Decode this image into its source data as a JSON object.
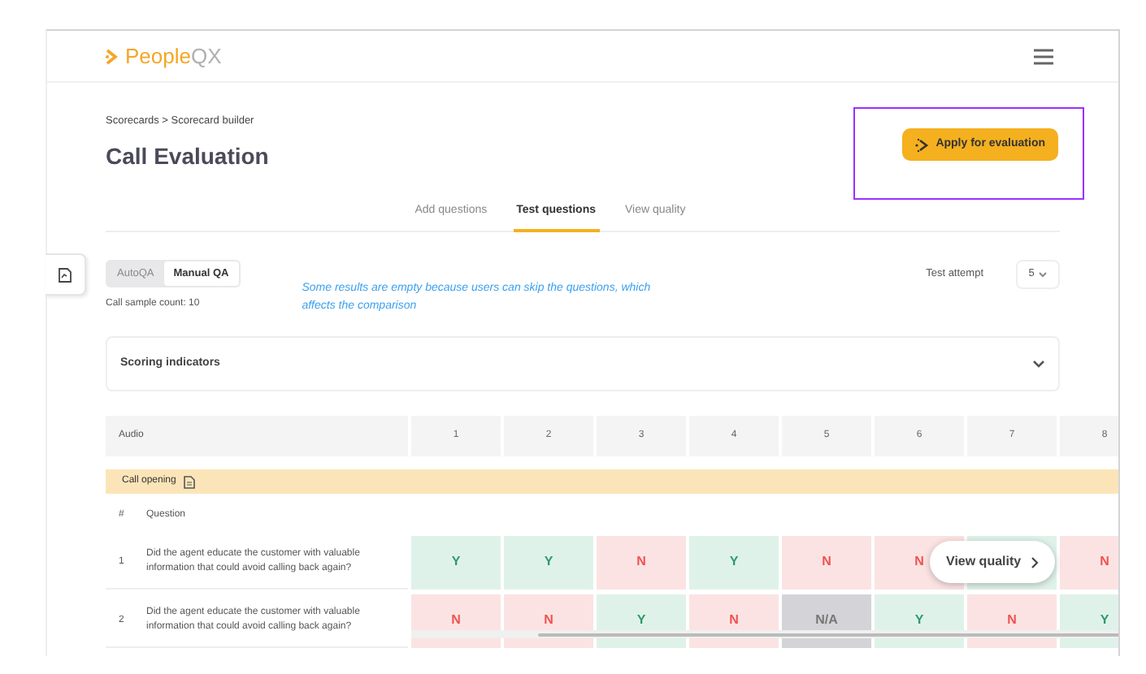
{
  "header": {
    "logo": {
      "prefix": "People",
      "suffix": "QX"
    }
  },
  "breadcrumb": "Scorecards > Scorecard builder",
  "title": "Call Evaluation",
  "apply_button": "Apply for evaluation",
  "tabs": [
    {
      "label": "Add questions",
      "selected": false
    },
    {
      "label": "Test questions",
      "selected": true
    },
    {
      "label": "View quality",
      "selected": false
    }
  ],
  "mode_toggle": [
    {
      "label": "AutoQA",
      "selected": false
    },
    {
      "label": "Manual QA",
      "selected": true
    }
  ],
  "sample_count": "Call sample count: 10",
  "note": "Some results are empty because users can skip the questions, which affects the comparison",
  "test_attempt": {
    "label": "Test attempt",
    "value": "5"
  },
  "scoring_indicators": {
    "label": "Scoring indicators",
    "expanded": false
  },
  "table": {
    "audio_label": "Audio",
    "columns": [
      "1",
      "2",
      "3",
      "4",
      "5",
      "6",
      "7",
      "8"
    ],
    "section": "Call opening",
    "number_label": "#",
    "question_label": "Question",
    "rows": [
      {
        "number": "1",
        "question": "Did the agent educate the customer with valuable information that could avoid calling back again?",
        "cells": [
          {
            "value": "Y",
            "kind": "yes"
          },
          {
            "value": "Y",
            "kind": "yes"
          },
          {
            "value": "N",
            "kind": "no"
          },
          {
            "value": "Y",
            "kind": "yes"
          },
          {
            "value": "N",
            "kind": "no"
          },
          {
            "value": "N",
            "kind": "no"
          },
          {
            "kind": "yes"
          },
          {
            "value": "N",
            "kind": "no"
          }
        ]
      },
      {
        "number": "2",
        "question": "Did the agent educate the customer with valuable information that could avoid calling back again?",
        "cells": [
          {
            "value": "N",
            "kind": "no"
          },
          {
            "value": "N",
            "kind": "no"
          },
          {
            "value": "Y",
            "kind": "yes"
          },
          {
            "value": "N",
            "kind": "no"
          },
          {
            "value": "N/A",
            "kind": "na"
          },
          {
            "value": "Y",
            "kind": "yes"
          },
          {
            "value": "N",
            "kind": "no"
          },
          {
            "value": "Y",
            "kind": "yes"
          }
        ]
      }
    ]
  },
  "view_quality_button": "View quality"
}
